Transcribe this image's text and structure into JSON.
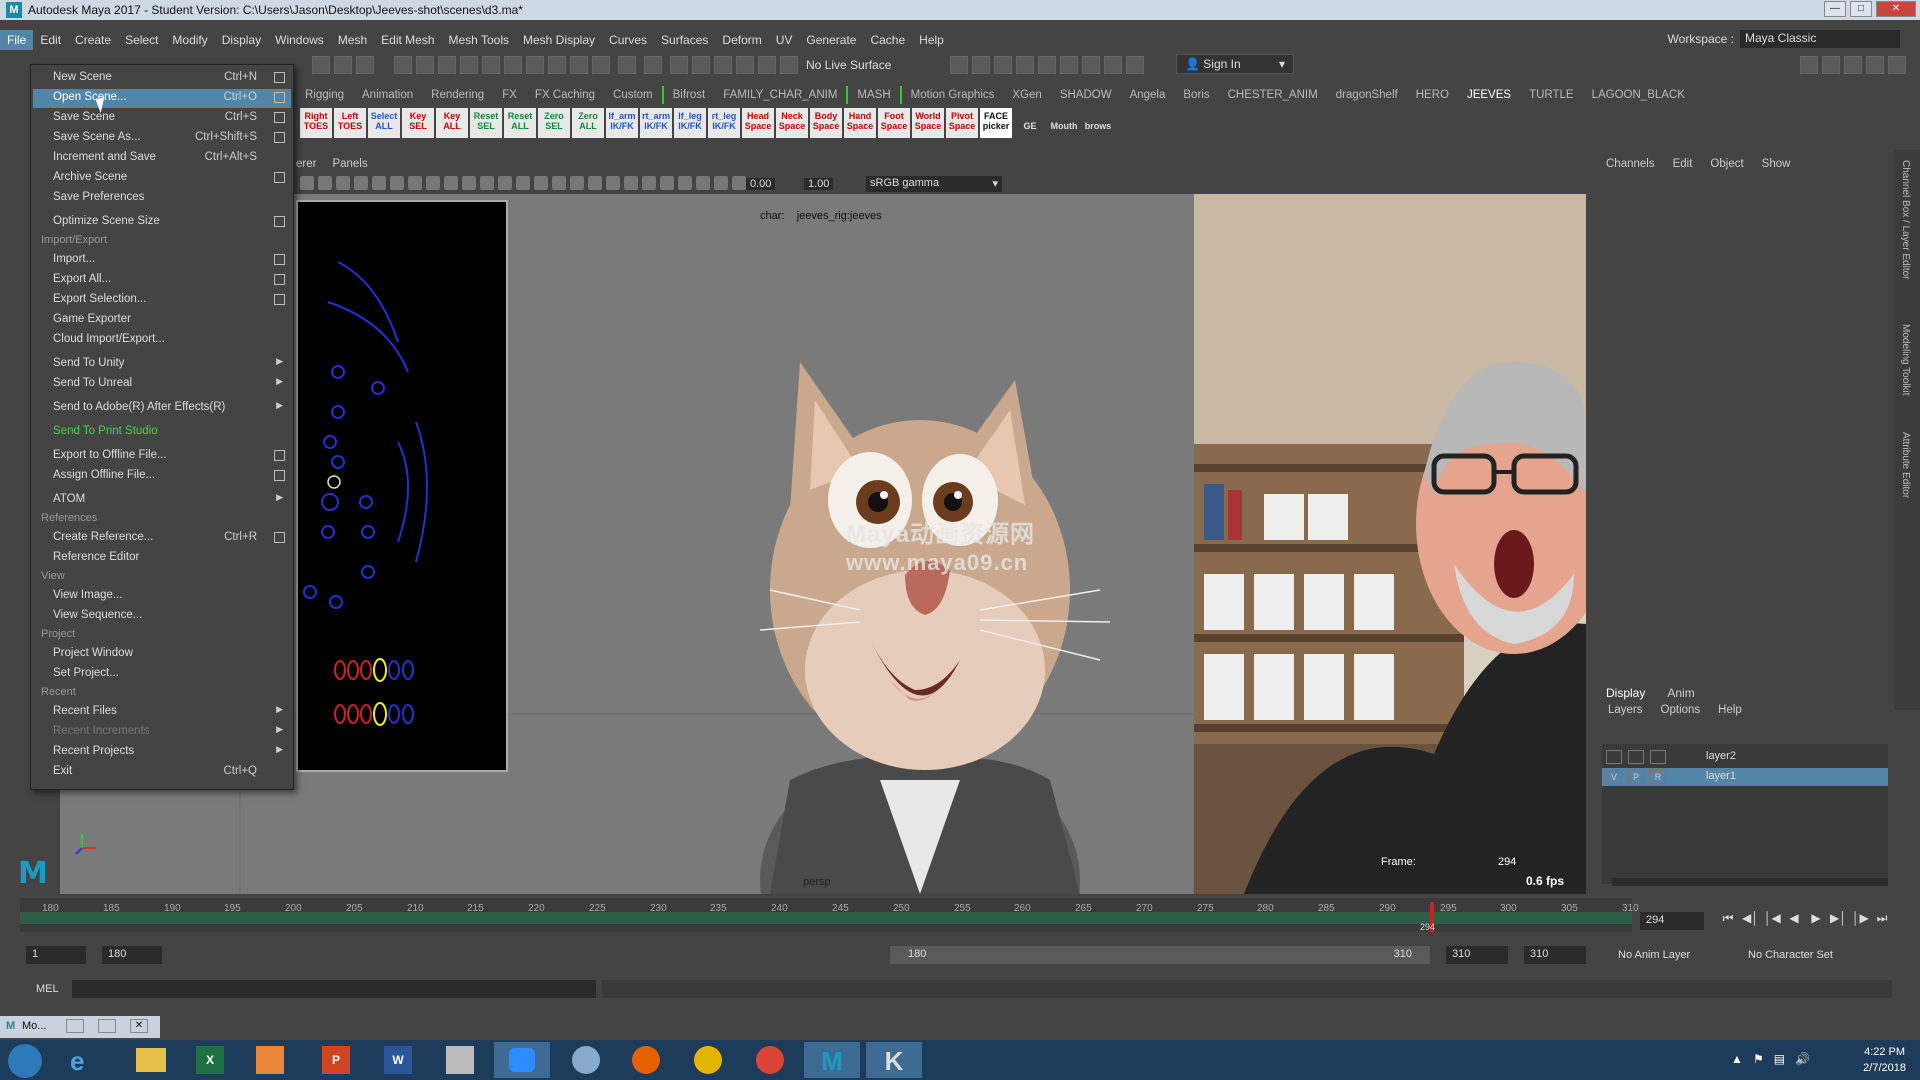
{
  "window": {
    "title": "Autodesk Maya 2017 - Student Version: C:\\Users\\Jason\\Desktop\\Jeeves-shot\\scenes\\d3.ma*",
    "logo": "M"
  },
  "menubar": {
    "items": [
      "File",
      "Edit",
      "Create",
      "Select",
      "Modify",
      "Display",
      "Windows",
      "Mesh",
      "Edit Mesh",
      "Mesh Tools",
      "Mesh Display",
      "Curves",
      "Surfaces",
      "Deform",
      "UV",
      "Generate",
      "Cache",
      "Help"
    ],
    "workspace_label": "Workspace :",
    "workspace_value": "Maya Classic"
  },
  "statusline": {
    "live_surface": "No Live Surface",
    "sign_in": "Sign In"
  },
  "shelf": {
    "tabs": [
      "Rigging",
      "Animation",
      "Rendering",
      "FX",
      "FX Caching",
      "Custom",
      "Bifrost",
      "FAMILY_CHAR_ANIM",
      "MASH",
      "Motion Graphics",
      "XGen",
      "SHADOW",
      "Angela",
      "Boris",
      "CHESTER_ANIM",
      "dragonShelf",
      "HERO",
      "JEEVES",
      "TURTLE",
      "LAGOON_BLACK"
    ],
    "active_tab": "JEEVES",
    "buttons": [
      {
        "line1": "Right",
        "line2": "TOES",
        "color": "red"
      },
      {
        "line1": "Left",
        "line2": "TOES",
        "color": "red"
      },
      {
        "line1": "Select",
        "line2": "ALL",
        "color": "blue"
      },
      {
        "line1": "Key",
        "line2": "SEL",
        "color": "red"
      },
      {
        "line1": "Key",
        "line2": "ALL",
        "color": "red"
      },
      {
        "line1": "Reset",
        "line2": "SEL",
        "color": "green"
      },
      {
        "line1": "Reset",
        "line2": "ALL",
        "color": "green"
      },
      {
        "line1": "Zero",
        "line2": "SEL",
        "color": "green"
      },
      {
        "line1": "Zero",
        "line2": "ALL",
        "color": "green"
      },
      {
        "line1": "lf_arm",
        "line2": "IK/FK",
        "color": "blue"
      },
      {
        "line1": "rt_arm",
        "line2": "IK/FK",
        "color": "blue"
      },
      {
        "line1": "lf_leg",
        "line2": "IK/FK",
        "color": "blue"
      },
      {
        "line1": "rt_leg",
        "line2": "IK/FK",
        "color": "blue"
      },
      {
        "line1": "Head",
        "line2": "Space",
        "color": "red"
      },
      {
        "line1": "Neck",
        "line2": "Space",
        "color": "red"
      },
      {
        "line1": "Body",
        "line2": "Space",
        "color": "red"
      },
      {
        "line1": "Hand",
        "line2": "Space",
        "color": "red"
      },
      {
        "line1": "Foot",
        "line2": "Space",
        "color": "red"
      },
      {
        "line1": "World",
        "line2": "Space",
        "color": "red"
      },
      {
        "line1": "Pivot",
        "line2": "Space",
        "color": "red"
      },
      {
        "line1": "FACE",
        "line2": "picker",
        "color": "black"
      },
      {
        "line1": "",
        "line2": "GE",
        "color": "teal"
      },
      {
        "line1": "",
        "line2": "Mouth",
        "color": "teal"
      },
      {
        "line1": "",
        "line2": "brows",
        "color": "teal"
      }
    ]
  },
  "panel": {
    "menus": [
      "erer",
      "Panels"
    ],
    "exposure": "0.00",
    "gamma": "1.00",
    "colorspace": "sRGB gamma"
  },
  "viewport": {
    "char_label": "char:",
    "char_value": "jeeves_rig:jeeves",
    "camera": "persp",
    "watermark1": "Maya动画资源网",
    "watermark2": "www.maya09.cn",
    "hud_frame_label": "Frame:",
    "hud_frame_value": "294",
    "hud_fps": "0.6 fps"
  },
  "channelbox": {
    "menus": [
      "Channels",
      "Edit",
      "Object",
      "Show"
    ],
    "side_tabs": [
      "Channel Box / Layer Editor",
      "Modeling Toolkit",
      "Attribute Editor"
    ]
  },
  "layers": {
    "tabs": [
      "Display",
      "Anim"
    ],
    "active_tab": "Display",
    "menus": [
      "Layers",
      "Options",
      "Help"
    ],
    "rows": [
      {
        "name": "layer2",
        "v": "",
        "p": "",
        "r": "",
        "selected": false
      },
      {
        "name": "layer1",
        "v": "V",
        "p": "P",
        "r": "R",
        "selected": true
      }
    ]
  },
  "timeline": {
    "ticks": [
      "180",
      "185",
      "190",
      "195",
      "200",
      "205",
      "210",
      "215",
      "220",
      "225",
      "230",
      "235",
      "240",
      "245",
      "250",
      "255",
      "260",
      "265",
      "270",
      "275",
      "280",
      "285",
      "290",
      "295",
      "300",
      "305",
      "310"
    ],
    "current_frame": "294",
    "cursor_label": "294"
  },
  "range": {
    "start": "1",
    "playback_start": "180",
    "slider_start": "180",
    "slider_end": "310",
    "playback_end": "310",
    "end": "310",
    "anim_layer": "No Anim Layer",
    "character_set": "No Character Set"
  },
  "commandline": {
    "label": "MEL"
  },
  "minimized_window": {
    "label": "Mo..."
  },
  "taskbar": {
    "time": "4:22 PM",
    "date": "2/7/2018"
  },
  "file_menu": {
    "items": [
      {
        "label": "New Scene",
        "shortcut": "Ctrl+N",
        "option": true
      },
      {
        "label": "Open Scene...",
        "shortcut": "Ctrl+O",
        "option": true,
        "highlight": true
      },
      {
        "label": "Save Scene",
        "shortcut": "Ctrl+S",
        "option": true
      },
      {
        "label": "Save Scene As...",
        "shortcut": "Ctrl+Shift+S",
        "option": true
      },
      {
        "label": "Increment and Save",
        "shortcut": "Ctrl+Alt+S",
        "option": false
      },
      {
        "label": "Archive Scene",
        "shortcut": "",
        "option": true
      },
      {
        "label": "Save Preferences",
        "shortcut": "",
        "option": false
      },
      {
        "label": "Optimize Scene Size",
        "shortcut": "",
        "option": true
      },
      {
        "section": "Import/Export"
      },
      {
        "label": "Import...",
        "shortcut": "",
        "option": true
      },
      {
        "label": "Export All...",
        "shortcut": "",
        "option": true
      },
      {
        "label": "Export Selection...",
        "shortcut": "",
        "option": true
      },
      {
        "label": "Game Exporter",
        "shortcut": "",
        "option": false
      },
      {
        "label": "Cloud Import/Export...",
        "shortcut": "",
        "option": false
      },
      {
        "label": "Send To Unity",
        "shortcut": "",
        "submenu": true
      },
      {
        "label": "Send To Unreal",
        "shortcut": "",
        "submenu": true
      },
      {
        "label": "Send to Adobe(R) After Effects(R)",
        "shortcut": "",
        "submenu": true
      },
      {
        "label": "Send To Print Studio",
        "shortcut": "",
        "green": true
      },
      {
        "label": "Export to Offline File...",
        "shortcut": "",
        "option": true
      },
      {
        "label": "Assign Offline File...",
        "shortcut": "",
        "option": true
      },
      {
        "label": "ATOM",
        "shortcut": "",
        "submenu": true
      },
      {
        "section": "References"
      },
      {
        "label": "Create Reference...",
        "shortcut": "Ctrl+R",
        "option": true
      },
      {
        "label": "Reference Editor",
        "shortcut": "",
        "option": false
      },
      {
        "section": "View"
      },
      {
        "label": "View Image...",
        "shortcut": "",
        "option": false
      },
      {
        "label": "View Sequence...",
        "shortcut": "",
        "option": false
      },
      {
        "section": "Project"
      },
      {
        "label": "Project Window",
        "shortcut": "",
        "option": false
      },
      {
        "label": "Set Project...",
        "shortcut": "",
        "option": false
      },
      {
        "section": "Recent"
      },
      {
        "label": "Recent Files",
        "shortcut": "",
        "submenu": true
      },
      {
        "label": "Recent Increments",
        "shortcut": "",
        "submenu": true,
        "disabled": true
      },
      {
        "label": "Recent Projects",
        "shortcut": "",
        "submenu": true
      },
      {
        "label": "Exit",
        "shortcut": "Ctrl+Q",
        "option": false
      }
    ]
  }
}
